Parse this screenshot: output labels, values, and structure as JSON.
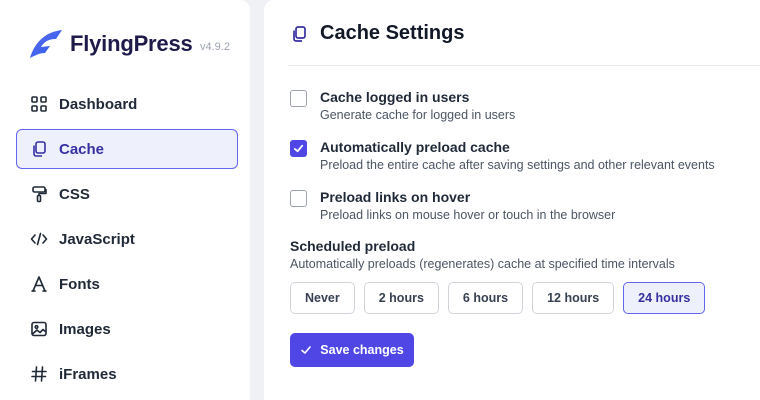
{
  "brand": {
    "name": "FlyingPress",
    "version": "v4.9.2",
    "logo_icon": "flyingpress-logo-icon"
  },
  "nav": {
    "items": [
      {
        "label": "Dashboard",
        "icon": "grid-icon",
        "active": false
      },
      {
        "label": "Cache",
        "icon": "copy-icon",
        "active": true
      },
      {
        "label": "CSS",
        "icon": "paint-roller-icon",
        "active": false
      },
      {
        "label": "JavaScript",
        "icon": "code-icon",
        "active": false
      },
      {
        "label": "Fonts",
        "icon": "font-icon",
        "active": false
      },
      {
        "label": "Images",
        "icon": "image-icon",
        "active": false
      },
      {
        "label": "iFrames",
        "icon": "hash-icon",
        "active": false
      }
    ]
  },
  "header": {
    "title": "Cache Settings",
    "icon": "copy-icon"
  },
  "options": [
    {
      "label": "Cache logged in users",
      "description": "Generate cache for logged in users",
      "checked": false
    },
    {
      "label": "Automatically preload cache",
      "description": "Preload the entire cache after saving settings and other relevant events",
      "checked": true
    },
    {
      "label": "Preload links on hover",
      "description": "Preload links on mouse hover or touch in the browser",
      "checked": false
    }
  ],
  "scheduled": {
    "title": "Scheduled preload",
    "description": "Automatically preloads (regenerates) cache at specified time intervals",
    "intervals": [
      "Never",
      "2 hours",
      "6 hours",
      "12 hours",
      "24 hours"
    ],
    "selected": "24 hours"
  },
  "save_label": "Save changes",
  "colors": {
    "accent": "#4f46e5",
    "accent_light": "#eef0fb",
    "accent_border": "#6366f1",
    "page_bg": "#f0f1f4"
  }
}
